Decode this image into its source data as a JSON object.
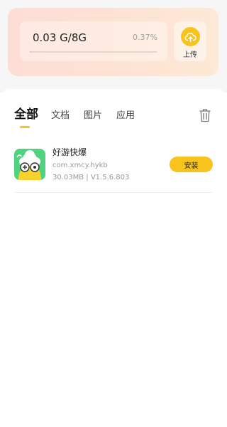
{
  "storage": {
    "usage_text": "0.03 G/8G",
    "percent_text": "0.37%",
    "progress_fraction": 0.0037,
    "upload_label": "上传",
    "accent_color": "#f8c31c"
  },
  "tabs": [
    {
      "label": "全部",
      "active": true
    },
    {
      "label": "文档",
      "active": false
    },
    {
      "label": "图片",
      "active": false
    },
    {
      "label": "应用",
      "active": false
    }
  ],
  "apps": [
    {
      "name": "好游快爆",
      "package": "com.xmcy.hykb",
      "meta": "30.03MB | V1.5.6.803",
      "action_label": "安装"
    }
  ]
}
